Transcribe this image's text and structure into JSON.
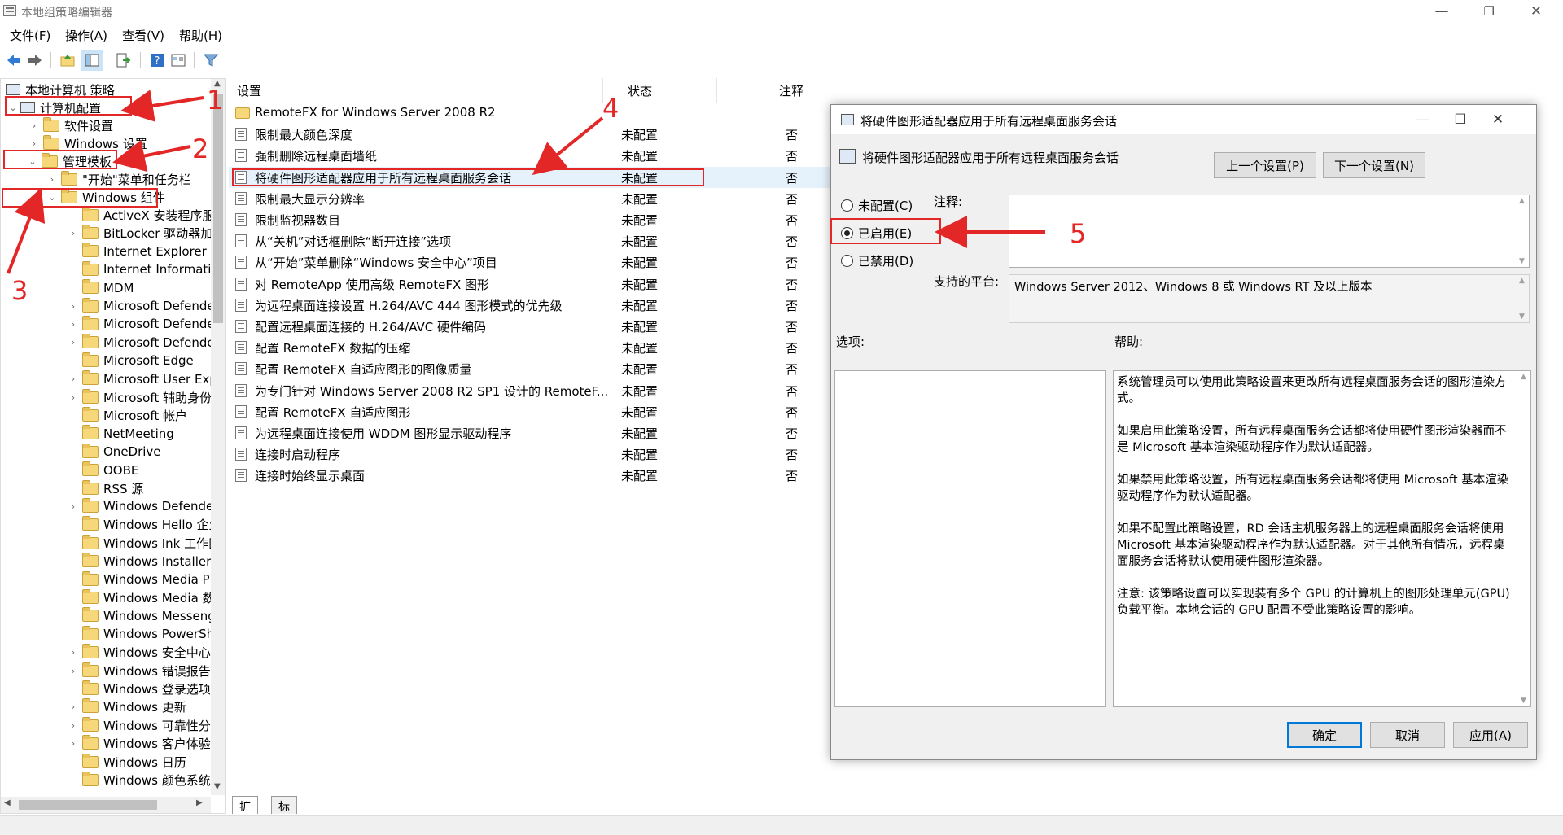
{
  "window": {
    "title": "本地组策略编辑器",
    "min": "—",
    "max": "❐",
    "close": "✕"
  },
  "menu": [
    "文件(F)",
    "操作(A)",
    "查看(V)",
    "帮助(H)"
  ],
  "tree": {
    "root": "本地计算机 策略",
    "computer_config": "计算机配置",
    "software_settings": "软件设置",
    "windows_settings": "Windows 设置",
    "admin_templates": "管理模板",
    "start_menu": "\"开始\"菜单和任务栏",
    "windows_components": "Windows 组件",
    "components": [
      "ActiveX 安装程序服",
      "BitLocker 驱动器加",
      "Internet Explorer",
      "Internet Informatio",
      "MDM",
      "Microsoft Defende",
      "Microsoft Defende",
      "Microsoft Defende",
      "Microsoft Edge",
      "Microsoft User Exp",
      "Microsoft 辅助身份",
      "Microsoft 帐户",
      "NetMeeting",
      "OneDrive",
      "OOBE",
      "RSS 源",
      "Windows Defende",
      "Windows Hello 企业",
      "Windows Ink 工作区",
      "Windows Installer",
      "Windows Media Pla",
      "Windows Media 数",
      "Windows Messeng",
      "Windows PowerSh",
      "Windows 安全中心",
      "Windows 错误报告",
      "Windows 登录选项",
      "Windows 更新",
      "Windows 可靠性分",
      "Windows 客户体验",
      "Windows 日历",
      "Windows 颜色系统"
    ]
  },
  "list": {
    "headers": {
      "setting": "设置",
      "state": "状态",
      "note": "注释"
    },
    "rows": [
      {
        "name": "RemoteFX for Windows Server 2008 R2",
        "state": "",
        "note": ""
      },
      {
        "name": "限制最大颜色深度",
        "state": "未配置",
        "note": "否"
      },
      {
        "name": "强制删除远程桌面墙纸",
        "state": "未配置",
        "note": "否"
      },
      {
        "name": "将硬件图形适配器应用于所有远程桌面服务会话",
        "state": "未配置",
        "note": "否"
      },
      {
        "name": "限制最大显示分辨率",
        "state": "未配置",
        "note": "否"
      },
      {
        "name": "限制监视器数目",
        "state": "未配置",
        "note": "否"
      },
      {
        "name": "从“关机”对话框删除“断开连接”选项",
        "state": "未配置",
        "note": "否"
      },
      {
        "name": "从“开始”菜单删除“Windows 安全中心”项目",
        "state": "未配置",
        "note": "否"
      },
      {
        "name": "对 RemoteApp 使用高级 RemoteFX 图形",
        "state": "未配置",
        "note": "否"
      },
      {
        "name": "为远程桌面连接设置 H.264/AVC 444 图形模式的优先级",
        "state": "未配置",
        "note": "否"
      },
      {
        "name": "配置远程桌面连接的 H.264/AVC 硬件编码",
        "state": "未配置",
        "note": "否"
      },
      {
        "name": "配置 RemoteFX 数据的压缩",
        "state": "未配置",
        "note": "否"
      },
      {
        "name": "配置 RemoteFX 自适应图形的图像质量",
        "state": "未配置",
        "note": "否"
      },
      {
        "name": "为专门针对 Windows Server 2008 R2 SP1 设计的 RemoteF...",
        "state": "未配置",
        "note": "否"
      },
      {
        "name": "配置 RemoteFX 自适应图形",
        "state": "未配置",
        "note": "否"
      },
      {
        "name": "为远程桌面连接使用 WDDM 图形显示驱动程序",
        "state": "未配置",
        "note": "否"
      },
      {
        "name": "连接时启动程序",
        "state": "未配置",
        "note": "否"
      },
      {
        "name": "连接时始终显示桌面",
        "state": "未配置",
        "note": "否"
      }
    ],
    "tabs": [
      "扩展",
      "标准"
    ]
  },
  "dialog": {
    "title": "将硬件图形适配器应用于所有远程桌面服务会话",
    "heading": "将硬件图形适配器应用于所有远程桌面服务会话",
    "prev": "上一个设置(P)",
    "next": "下一个设置(N)",
    "not_configured": "未配置(C)",
    "enabled": "已启用(E)",
    "disabled": "已禁用(D)",
    "note_label": "注释:",
    "platform_label": "支持的平台:",
    "platform": "Windows Server 2012、Windows 8 或 Windows RT 及以上版本",
    "options_label": "选项:",
    "help_label": "帮助:",
    "help": [
      "系统管理员可以使用此策略设置来更改所有远程桌面服务会话的图形渲染方式。",
      "如果启用此策略设置，所有远程桌面服务会话都将使用硬件图形渲染器而不是 Microsoft 基本渲染驱动程序作为默认适配器。",
      "如果禁用此策略设置，所有远程桌面服务会话都将使用 Microsoft 基本渲染驱动程序作为默认适配器。",
      "如果不配置此策略设置，RD 会话主机服务器上的远程桌面服务会话将使用 Microsoft 基本渲染驱动程序作为默认适配器。对于其他所有情况，远程桌面服务会话将默认使用硬件图形渲染器。",
      "注意: 该策略设置可以实现装有多个 GPU 的计算机上的图形处理单元(GPU)负载平衡。本地会话的 GPU 配置不受此策略设置的影响。"
    ],
    "ok": "确定",
    "cancel": "取消",
    "apply": "应用(A)"
  },
  "annotations": [
    "1",
    "2",
    "3",
    "4",
    "5"
  ],
  "colors": {
    "annotation": "#e32626",
    "selection": "#e5f1fb",
    "accent": "#0078d7"
  }
}
